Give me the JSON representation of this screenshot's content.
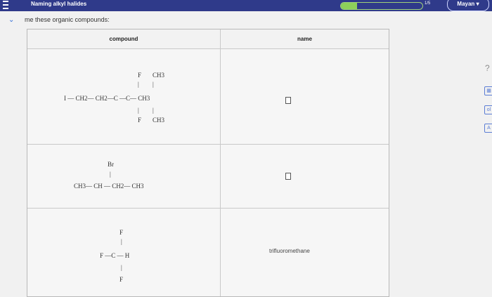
{
  "header": {
    "title": "Naming alkyl halides",
    "progress_label": "1/5",
    "progress_fraction": 0.2,
    "user_name": "Mayan",
    "user_chevron": "▾"
  },
  "instruction": "me these organic compounds:",
  "table": {
    "columns": [
      "compound",
      "name"
    ],
    "rows": [
      {
        "compound_labels": {
          "top_f": "F",
          "top_ch3": "CH3",
          "main_chain": "I — CH2— CH2—C —C— CH3",
          "bottom_f": "F",
          "bottom_ch3": "CH3"
        },
        "name_value": ""
      },
      {
        "compound_labels": {
          "top_br": "Br",
          "main_chain": "CH3— CH — CH2— CH3"
        },
        "name_value": ""
      },
      {
        "compound_labels": {
          "top_f": "F",
          "main_chain": "F —C — H",
          "bottom_f": "F"
        },
        "name_value": "trifluoromethane"
      }
    ]
  },
  "icons": {
    "menu": "menu-icon",
    "collapse": "chevron-down-icon",
    "question": "question-icon",
    "tool1": "periodic-table-icon",
    "tool2": "chart-icon",
    "tool3": "text-icon"
  },
  "tools": {
    "question_text": "?",
    "tool1_text": "▦",
    "tool2_text": "ol",
    "tool3_text": "A"
  }
}
